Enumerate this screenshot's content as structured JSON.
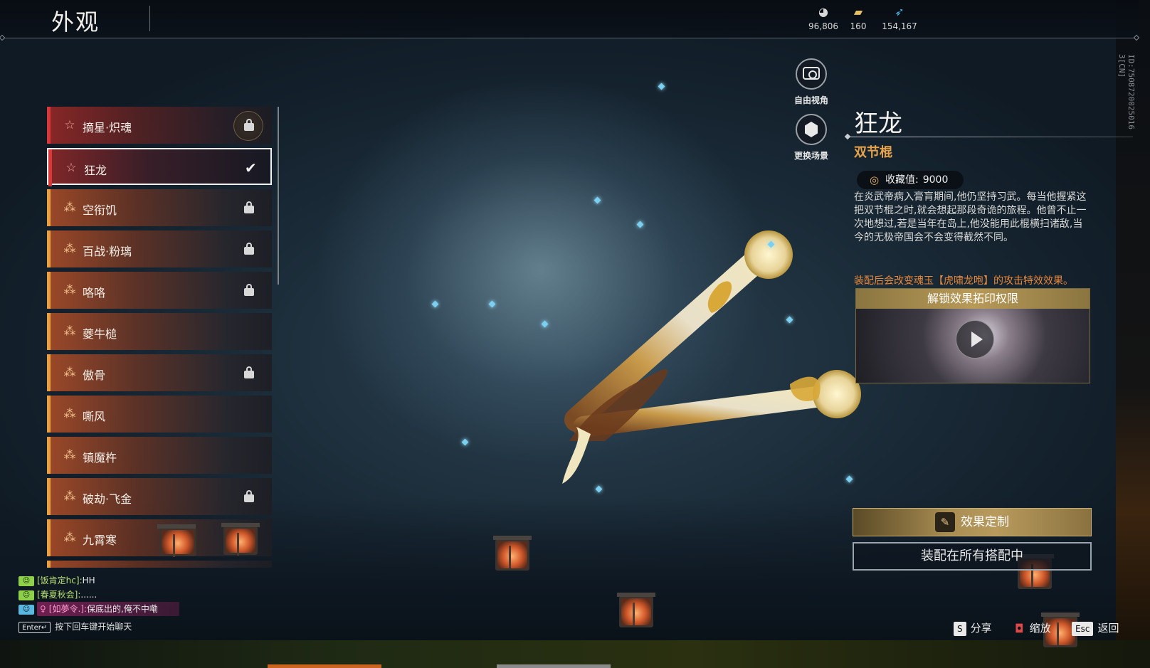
{
  "header": {
    "title": "外观",
    "currencies": [
      {
        "icon": "coin-icon",
        "value": "96,806"
      },
      {
        "icon": "ticket-icon",
        "value": "160"
      },
      {
        "icon": "feather-icon",
        "value": "154,167"
      }
    ]
  },
  "side_id": "ID:7508720025016 3[CN]",
  "list": {
    "items": [
      {
        "name": "摘星·炽魂",
        "rarity": "red",
        "icon": "star-outline-icon",
        "locked": true
      },
      {
        "name": "狂龙",
        "rarity": "red",
        "icon": "star-outline-icon",
        "locked": false,
        "selected": true
      },
      {
        "name": "空衔饥",
        "rarity": "orange",
        "icon": "cross-rank-icon",
        "locked": true
      },
      {
        "name": "百战·粉璃",
        "rarity": "orange",
        "icon": "cross-rank-icon",
        "locked": true
      },
      {
        "name": "咯咯",
        "rarity": "orange",
        "icon": "cross-rank-icon",
        "locked": true
      },
      {
        "name": "夔牛槌",
        "rarity": "orange",
        "icon": "cross-rank-icon",
        "locked": false
      },
      {
        "name": "傲骨",
        "rarity": "orange",
        "icon": "cross-rank-icon",
        "locked": true
      },
      {
        "name": "嘶风",
        "rarity": "orange",
        "icon": "cross-rank-icon",
        "locked": false
      },
      {
        "name": "镇魔杵",
        "rarity": "orange",
        "icon": "cross-rank-icon",
        "locked": false
      },
      {
        "name": "破劫·飞金",
        "rarity": "orange",
        "icon": "cross-rank-icon",
        "locked": true
      },
      {
        "name": "九霄寒",
        "rarity": "orange",
        "icon": "cross-rank-icon",
        "locked": false
      }
    ]
  },
  "tools": {
    "free_camera": "自由视角",
    "change_scene": "更换场景"
  },
  "detail": {
    "name": "狂龙",
    "type": "双节棍",
    "collection_label": "收藏值:",
    "collection_value": "9000",
    "description": "在炎武帝病入膏肓期间,他仍坚持习武。每当他握紧这把双节棍之时,就会想起那段奇诡的旅程。他曾不止一次地想过,若是当年在岛上,他没能用此棍横扫诸敌,当今的无极帝国会不会变得截然不同。",
    "equip_note": "装配后会改变魂玉【虎啸龙咆】的攻击特效效果。",
    "unlock_title": "解锁效果拓印权限",
    "effect_button": "效果定制",
    "equip_button": "装配在所有搭配中"
  },
  "chat": {
    "lines": [
      {
        "name": "[饭肯定hc]:",
        "text": "HH",
        "style": "green"
      },
      {
        "name": "[春夏秋会]:",
        "text": "......",
        "style": "green"
      },
      {
        "name": "[如夢令.]:",
        "text": "保底出的,俺不中嘞",
        "style": "pink"
      }
    ],
    "hint_key": "Enter↵",
    "hint_text": "按下回车键开始聊天"
  },
  "hints": [
    {
      "key": "S",
      "label": "分享"
    },
    {
      "key": "mouse-icon",
      "label": "缩放"
    },
    {
      "key": "Esc",
      "label": "返回"
    }
  ]
}
